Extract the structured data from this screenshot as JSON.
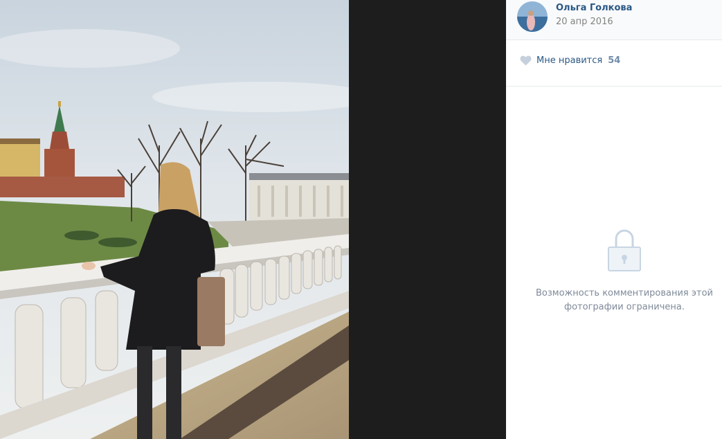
{
  "author": {
    "name": "Ольга Голкова",
    "date": "20 апр 2016"
  },
  "likes": {
    "label": "Мне нравится",
    "count": "54"
  },
  "comments": {
    "restricted_text": "Возможность комментирования этой фотографии ограничена."
  },
  "icons": {
    "like": "heart-icon",
    "restricted": "lock-icon"
  },
  "colors": {
    "link": "#2a5885",
    "viewer_bg": "#1d1d1d"
  }
}
